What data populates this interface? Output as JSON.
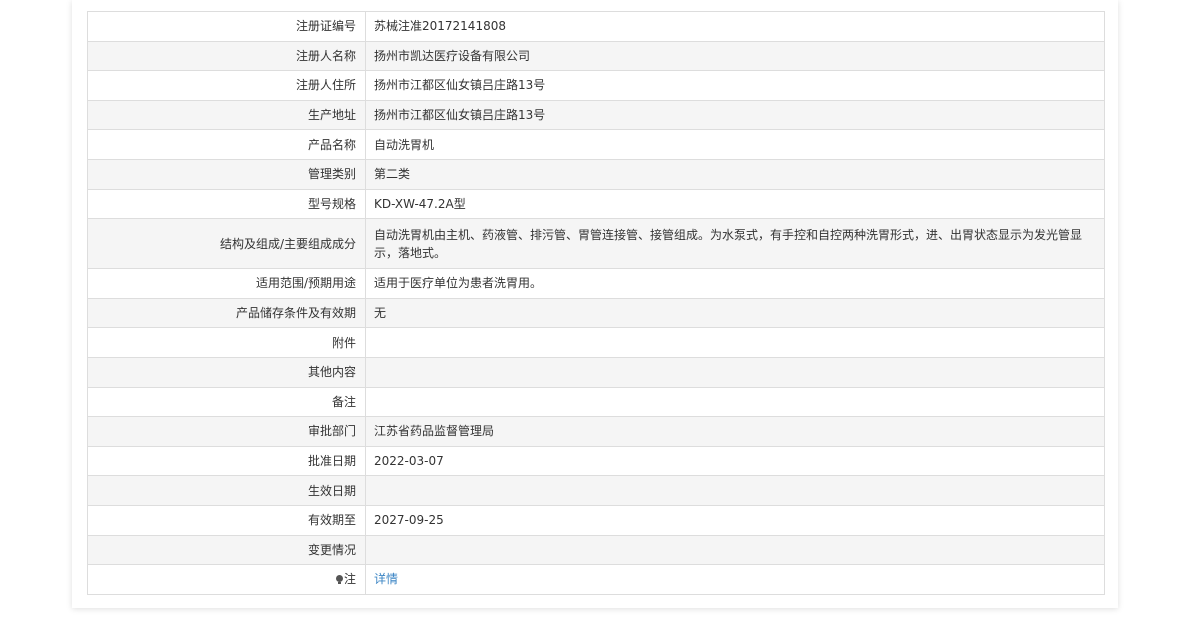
{
  "rows": [
    {
      "label": "注册证编号",
      "value": "苏械注准20172141808"
    },
    {
      "label": "注册人名称",
      "value": "扬州市凯达医疗设备有限公司"
    },
    {
      "label": "注册人住所",
      "value": "扬州市江都区仙女镇吕庄路13号"
    },
    {
      "label": "生产地址",
      "value": "扬州市江都区仙女镇吕庄路13号"
    },
    {
      "label": "产品名称",
      "value": "自动洗胃机"
    },
    {
      "label": "管理类别",
      "value": "第二类"
    },
    {
      "label": "型号规格",
      "value": "KD-XW-47.2A型"
    },
    {
      "label": "结构及组成/主要组成成分",
      "value": "自动洗胃机由主机、药液管、排污管、胃管连接管、接管组成。为水泵式，有手控和自控两种洗胃形式，进、出胃状态显示为发光管显示，落地式。"
    },
    {
      "label": "适用范围/预期用途",
      "value": "适用于医疗单位为患者洗胃用。"
    },
    {
      "label": "产品储存条件及有效期",
      "value": "无"
    },
    {
      "label": "附件",
      "value": ""
    },
    {
      "label": "其他内容",
      "value": ""
    },
    {
      "label": "备注",
      "value": ""
    },
    {
      "label": "审批部门",
      "value": "江苏省药品监督管理局"
    },
    {
      "label": "批准日期",
      "value": "2022-03-07"
    },
    {
      "label": "生效日期",
      "value": ""
    },
    {
      "label": "有效期至",
      "value": "2027-09-25"
    },
    {
      "label": "变更情况",
      "value": ""
    }
  ],
  "note": {
    "label": "注",
    "icon": "lightbulb-icon",
    "link_text": "详情"
  },
  "colors": {
    "link": "#3a84c4",
    "border": "#dddddd",
    "stripe": "#f5f5f5",
    "text": "#333333"
  }
}
